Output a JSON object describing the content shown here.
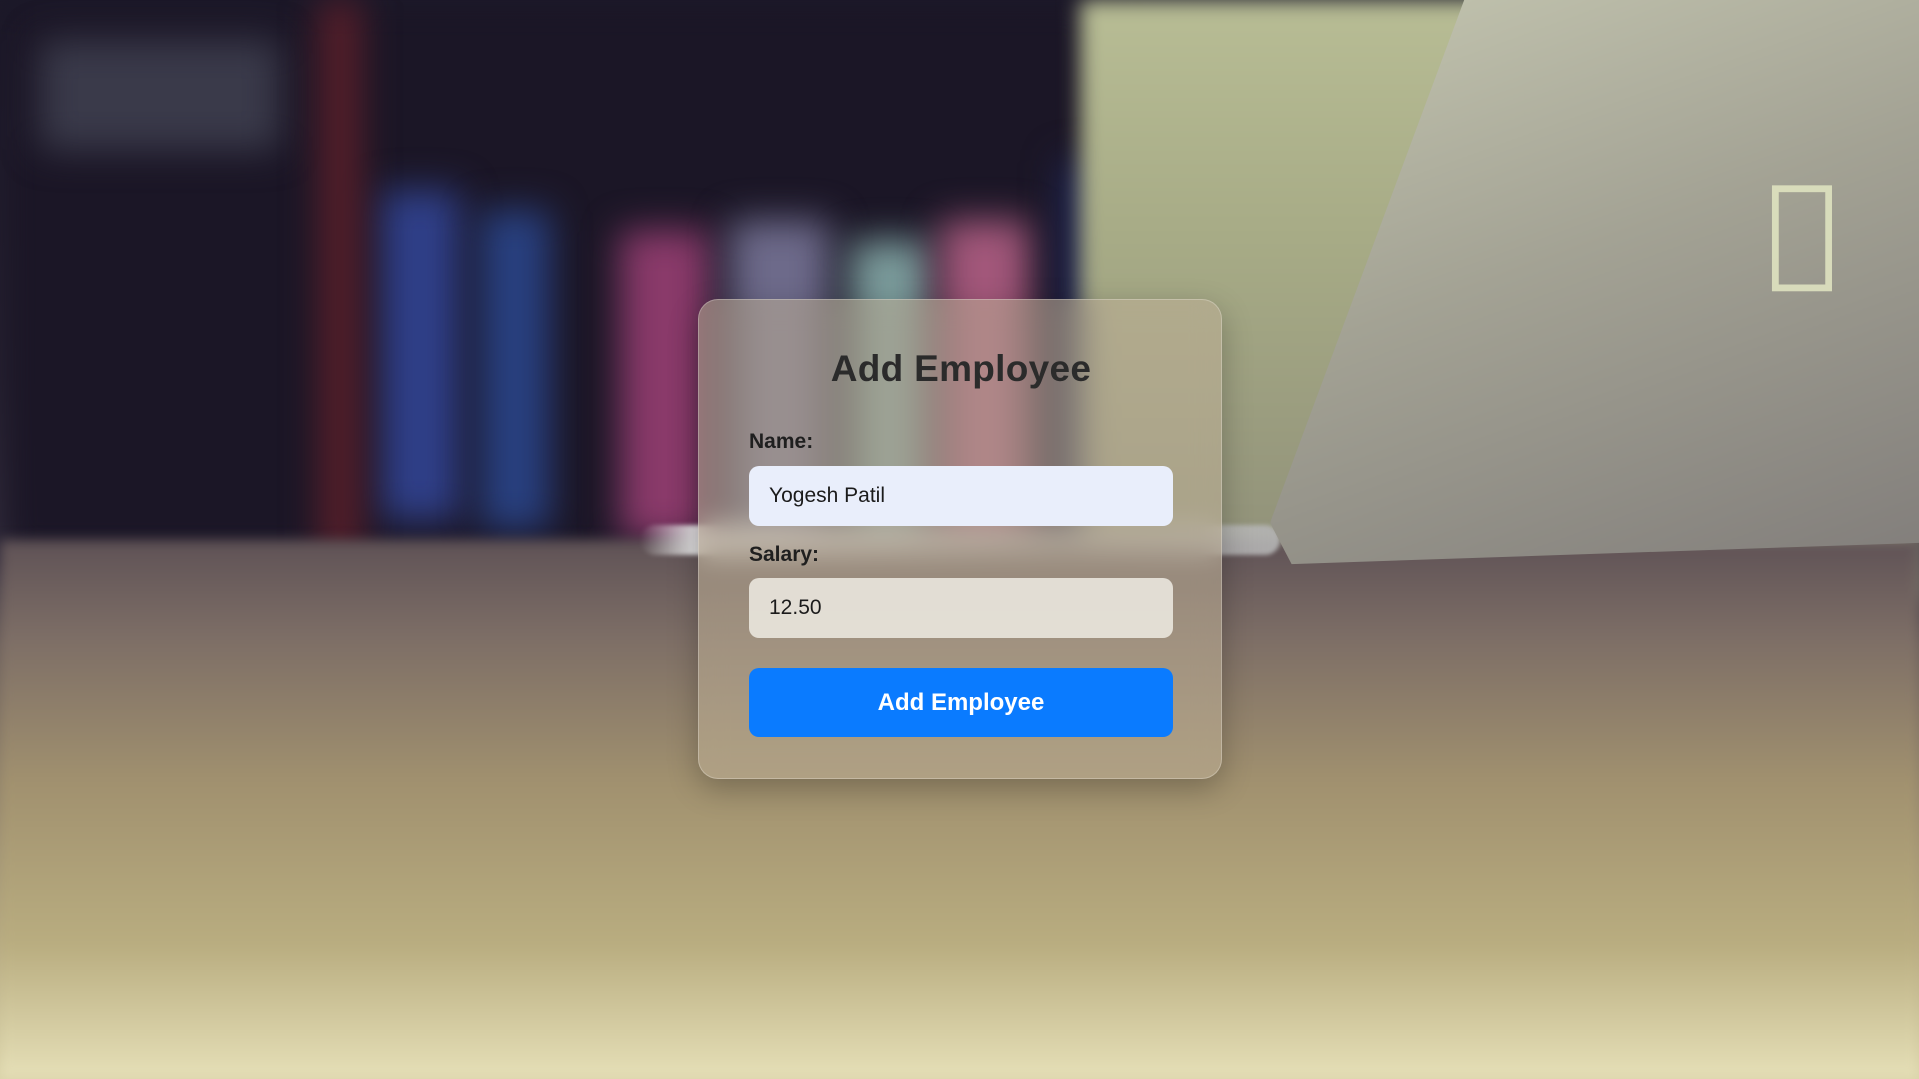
{
  "form": {
    "title": "Add Employee",
    "name_label": "Name:",
    "name_value": "Yogesh Patil",
    "salary_label": "Salary:",
    "salary_value": "12.50",
    "submit_label": "Add Employee"
  },
  "colors": {
    "accent": "#0a7bff",
    "title_text": "#2b2b2b",
    "name_input_bg": "#e9eefb"
  },
  "background": {
    "laptop_logo_icon": "apple-logo-icon"
  }
}
